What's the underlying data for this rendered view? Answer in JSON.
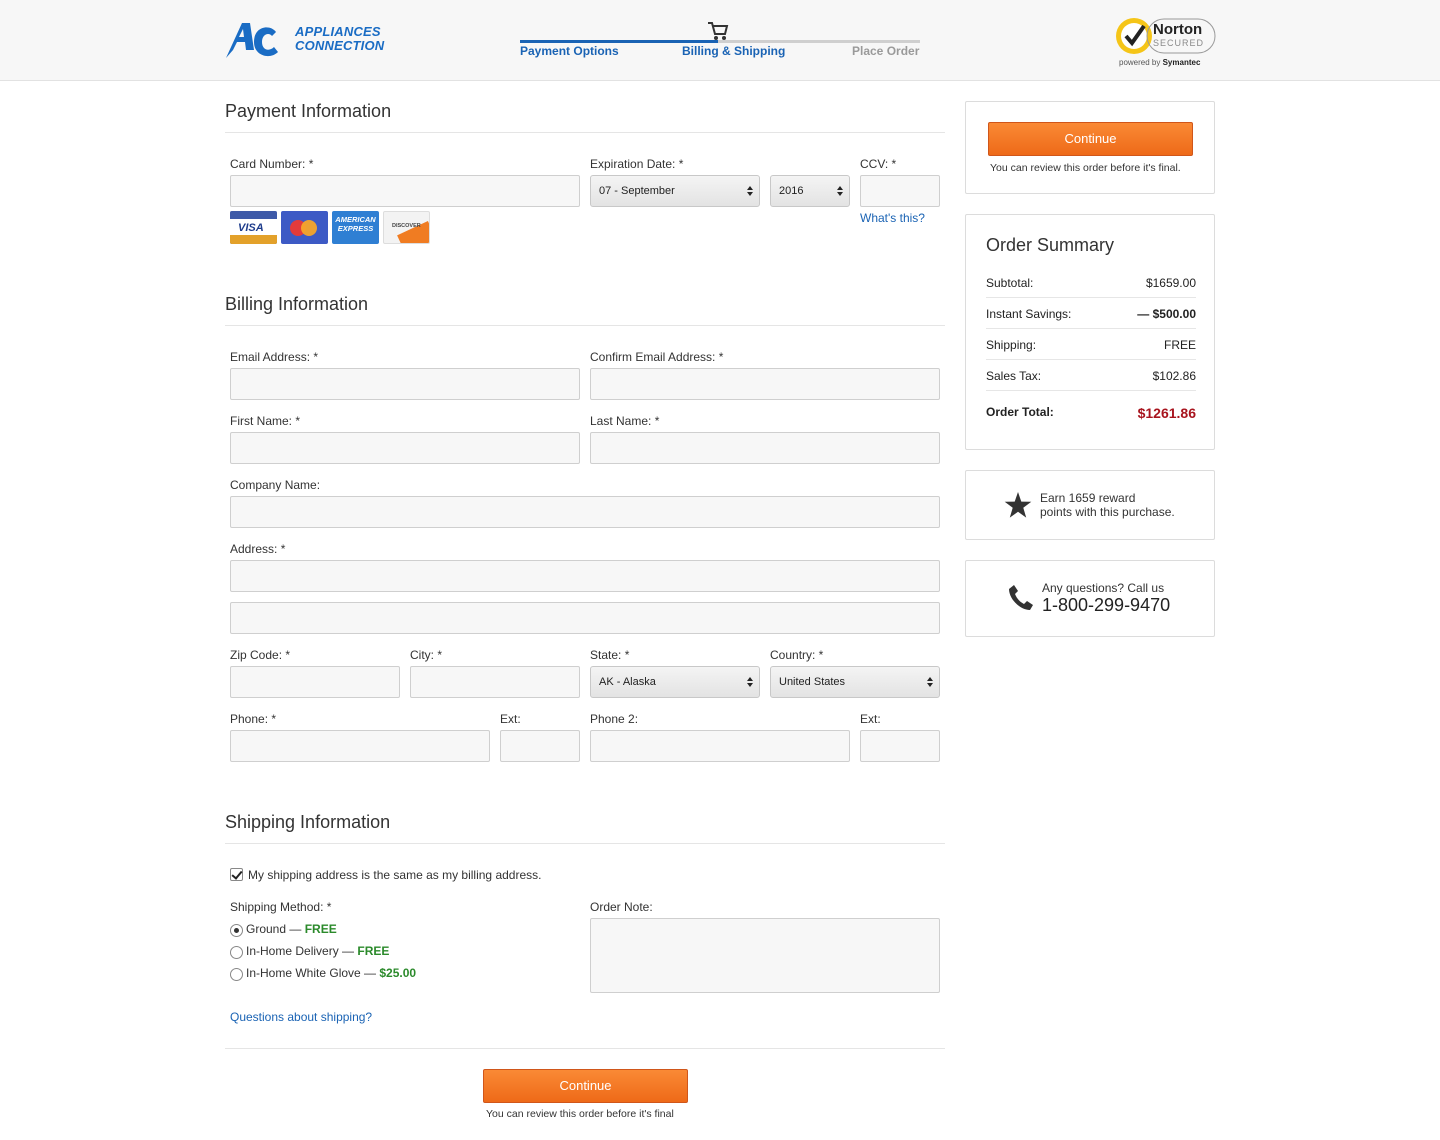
{
  "header": {
    "logo_line1": "APPLIANCES",
    "logo_line2": "CONNECTION",
    "steps": [
      {
        "label": "Payment Options",
        "state": "done"
      },
      {
        "label": "Billing & Shipping",
        "state": "current"
      },
      {
        "label": "Place Order",
        "state": "upcoming"
      }
    ],
    "norton_word": "Norton",
    "norton_sub": "SECURED",
    "norton_powered": "powered by",
    "norton_symantec": "Symantec"
  },
  "payment": {
    "title": "Payment Information",
    "card_number_label": "Card Number: *",
    "expiration_label": "Expiration Date: *",
    "month_value": "07 - September",
    "year_value": "2016",
    "ccv_label": "CCV: *",
    "whats_this": "What's this?",
    "cards": {
      "visa": "VISA",
      "amex": "AMERICAN EXPRESS",
      "discover": "DISCOVER"
    }
  },
  "billing": {
    "title": "Billing Information",
    "email_label": "Email Address: *",
    "confirm_email_label": "Confirm Email Address: *",
    "first_name_label": "First Name: *",
    "last_name_label": "Last Name: *",
    "company_label": "Company Name:",
    "address_label": "Address: *",
    "zip_label": "Zip Code: *",
    "city_label": "City: *",
    "state_label": "State: *",
    "state_value": "AK - Alaska",
    "country_label": "Country: *",
    "country_value": "United States",
    "phone_label": "Phone: *",
    "ext_label": "Ext:",
    "phone2_label": "Phone 2:",
    "ext2_label": "Ext:"
  },
  "shipping": {
    "title": "Shipping Information",
    "same_address_label": "My shipping address is the same as my billing address.",
    "same_address_checked": true,
    "method_label": "Shipping Method: *",
    "methods": [
      {
        "name": "Ground — ",
        "price": "FREE",
        "selected": true
      },
      {
        "name": "In-Home Delivery — ",
        "price": "FREE",
        "selected": false
      },
      {
        "name": "In-Home White Glove — ",
        "price": "$25.00",
        "selected": false
      }
    ],
    "order_note_label": "Order Note:",
    "questions_link": "Questions about shipping?"
  },
  "footer_action": {
    "continue_label": "Continue",
    "note": "You can review this order before it's final"
  },
  "sidebar": {
    "continue_label": "Continue",
    "continue_note": "You can review this order before it's final.",
    "order_summary": {
      "title": "Order Summary",
      "rows": [
        {
          "label": "Subtotal:",
          "value": "$1659.00"
        },
        {
          "label": "Instant Savings:",
          "value": "— $500.00"
        },
        {
          "label": "Shipping:",
          "value": "FREE"
        },
        {
          "label": "Sales Tax:",
          "value": "$102.86"
        }
      ],
      "total_label": "Order Total:",
      "total_value": "$1261.86"
    },
    "rewards_line1": "Earn 1659 reward",
    "rewards_line2": "points with this purchase.",
    "questions_line": "Any questions? Call us",
    "phone_number": "1-800-299-9470"
  },
  "colors": {
    "brand_blue": "#1a63b4",
    "cta_orange": "#ee6a18",
    "free_green": "#2b8a2b",
    "total_red": "#a8141e"
  }
}
